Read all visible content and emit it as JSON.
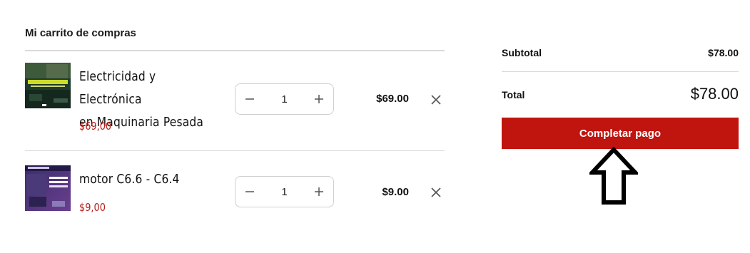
{
  "cart": {
    "title": "Mi carrito de compras",
    "items": [
      {
        "name_line1": "Electricidad y Electrónica",
        "name_line2": "en Maquinaria Pesada",
        "unit_price": "$69,00",
        "quantity": "1",
        "line_total": "$69.00",
        "thumb_icon": "course-cover-electricidad-image"
      },
      {
        "name_line1": "motor C6.6 - C6.4",
        "unit_price": "$9,00",
        "quantity": "1",
        "line_total": "$9.00",
        "thumb_icon": "course-cover-motor-image"
      }
    ],
    "icons": {
      "decrease": "minus-icon",
      "increase": "plus-icon",
      "remove": "close-icon"
    }
  },
  "summary": {
    "subtotal_label": "Subtotal",
    "subtotal_value": "$78.00",
    "total_label": "Total",
    "total_value": "$78.00",
    "pay_button_label": "Completar pago"
  },
  "annotation": {
    "icon": "up-arrow-icon"
  },
  "colors": {
    "accent": "#c0140e",
    "price_red": "#b3201b",
    "divider": "#d9d9d9"
  }
}
